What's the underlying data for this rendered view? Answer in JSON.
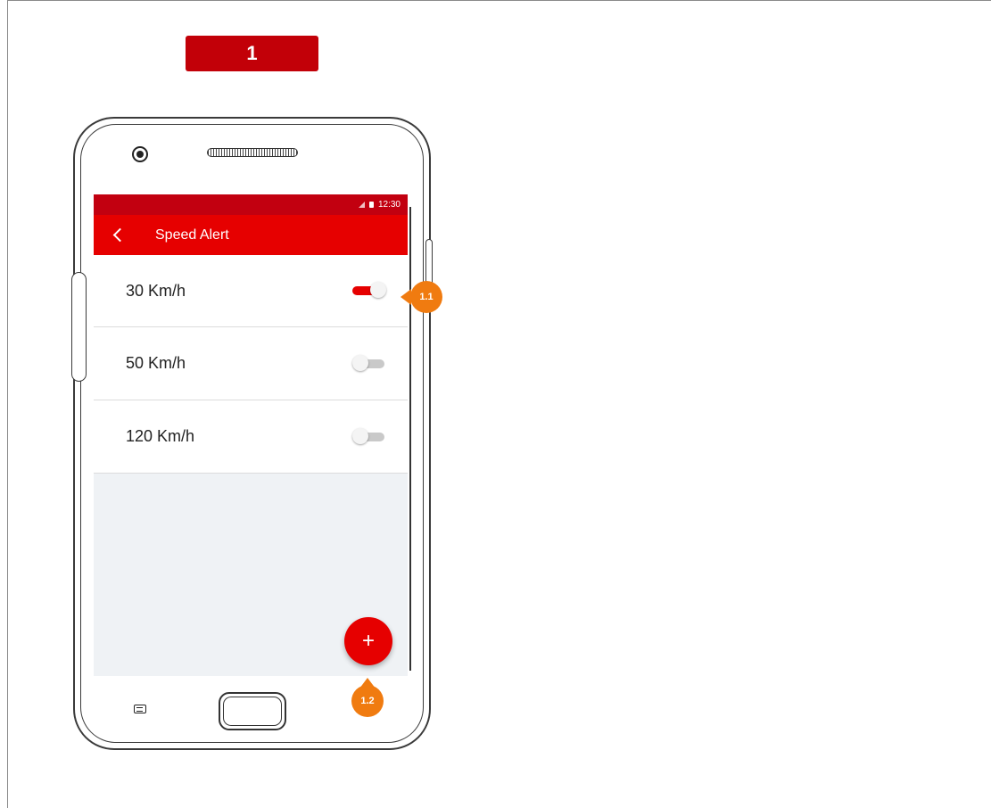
{
  "step_badge": "1",
  "status_bar": {
    "time": "12:30"
  },
  "app_bar": {
    "title": "Speed Alert"
  },
  "speed_alerts": [
    {
      "label": "30 Km/h",
      "enabled": true
    },
    {
      "label": "50 Km/h",
      "enabled": false
    },
    {
      "label": "120 Km/h",
      "enabled": false
    }
  ],
  "fab": {
    "label": "+"
  },
  "annotations": [
    {
      "label": "1.1"
    },
    {
      "label": "1.2"
    }
  ],
  "colors": {
    "status_bar": "#c20010",
    "app_bar": "#e60000",
    "toggle_on": "#e60000",
    "marker": "#f07b10",
    "step_badge": "#c20008"
  },
  "icons": {
    "back": "chevron-left-icon",
    "signal": "signal-icon",
    "battery": "battery-icon",
    "add": "plus-icon"
  }
}
